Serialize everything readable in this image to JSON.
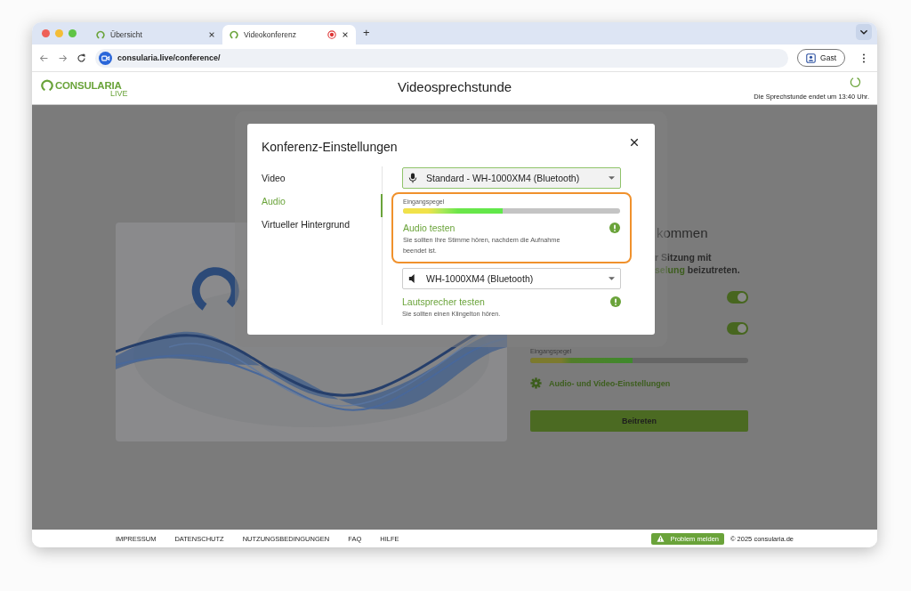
{
  "browser": {
    "tabs": [
      {
        "title": "Übersicht",
        "selected": false,
        "recording": false
      },
      {
        "title": "Videokonferenz",
        "selected": true,
        "recording": true
      }
    ],
    "new_tab": "+",
    "address": "consularia.live/conference/",
    "profile": "Gast"
  },
  "header": {
    "logo": "CONSULARIA",
    "logo_sub": "LIVE",
    "title": "Videosprechstunde",
    "notice": "Die Sprechstunde endet um 13:40 Uhr."
  },
  "lobby": {
    "title_fragment": "kommen",
    "text_line": "r Sitzung mit",
    "link": "selung",
    "text_rest": "beizutreten.",
    "toggles": [
      {
        "on": true
      },
      {
        "on": true
      }
    ],
    "meter_label": "Eingangspegel",
    "meter": {
      "level": 0.47
    },
    "settings_link": "Audio- und Video-Einstellungen",
    "join_button": "Beitreten"
  },
  "dialog": {
    "title": "Konferenz-Einstellungen",
    "nav": [
      {
        "label": "Video",
        "selected": false
      },
      {
        "label": "Audio",
        "selected": true
      },
      {
        "label": "Virtueller Hintergrund",
        "selected": false
      }
    ],
    "microphone": "Standard - WH-1000XM4 (Bluetooth)",
    "input_level": {
      "label": "Eingangspegel",
      "level": 0.46,
      "highlighted": true
    },
    "audio_test": {
      "label": "Audio testen",
      "hint": "Sie sollten Ihre Stimme hören, nachdem die Aufnahme beendet ist."
    },
    "speaker": "WH-1000XM4 (Bluetooth)",
    "speaker_test": {
      "label": "Lautsprecher testen",
      "hint": "Sie sollten einen Klingelton hören."
    }
  },
  "footer": {
    "links": [
      "IMPRESSUM",
      "DATENSCHUTZ",
      "NUTZUNGSBEDINGUNGEN",
      "FAQ",
      "HILFE"
    ],
    "report_button": "Problem melden",
    "copyright": "© 2025 consularia.de"
  }
}
